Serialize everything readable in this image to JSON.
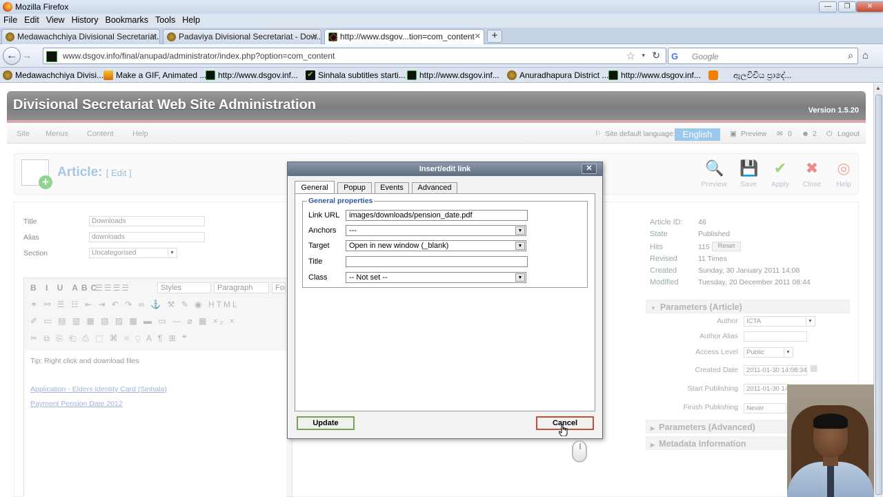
{
  "window": {
    "title": "Mozilla Firefox",
    "min": "—",
    "max": "❐",
    "close": "✕"
  },
  "menubar": [
    "File",
    "Edit",
    "View",
    "History",
    "Bookmarks",
    "Tools",
    "Help"
  ],
  "tabs": [
    {
      "label": "Medawachchiya Divisional Secretariat..."
    },
    {
      "label": "Padaviya Divisional Secretariat - Dow..."
    },
    {
      "label": "http://www.dsgov...tion=com_content"
    }
  ],
  "newtab": "+",
  "navbar": {
    "back": "←",
    "forward": "→",
    "url": "www.dsgov.info/final/anupad/administrator/index.php?option=com_content",
    "star": "☆",
    "drop": "▾",
    "reload": "↻",
    "search_engine": "G",
    "search_placeholder": "Google",
    "search_icon": "⌕",
    "home": "⌂"
  },
  "bookmarks": [
    "Medawachchiya Divisi...",
    "Make a GIF, Animated ...",
    "http://www.dsgov.inf...",
    "Sinhala subtitles starti...",
    "http://www.dsgov.inf...",
    "Anuradhapura District ...",
    "http://www.dsgov.inf...",
    "ඇලවිචිය ප්‍රාදේ..."
  ],
  "bookmark_icon_sinhala": "✔",
  "admin": {
    "title": "Divisional Secretariat Web Site Administration",
    "version": "Version 1.5.20",
    "menu": [
      "Site",
      "Menus",
      "Content",
      "Help"
    ],
    "lang_label": "Site default language:",
    "lang_value": "English",
    "status": {
      "preview": "Preview",
      "messages": "0",
      "users": "2",
      "logout": "Logout"
    }
  },
  "toolbar": {
    "title": "Article:",
    "subtitle": "[ Edit ]",
    "plus": "+",
    "buttons": [
      {
        "label": "Preview",
        "glyph": "🔍"
      },
      {
        "label": "Save",
        "glyph": "💾"
      },
      {
        "label": "Apply",
        "glyph": "✔"
      },
      {
        "label": "Close",
        "glyph": "✖"
      },
      {
        "label": "Help",
        "glyph": "◎"
      }
    ]
  },
  "form": {
    "title_label": "Title",
    "title_value": "Downloads",
    "alias_label": "Alias",
    "alias_value": "downloads",
    "section_label": "Section",
    "section_value": "Uncategorised"
  },
  "editor": {
    "row1": "B I U ABC",
    "styles": "Styles",
    "paragraph": "Paragraph",
    "font": "Fon",
    "row2": "⚭ ⚯ ☰ ☷ ⇤ ⇥ ↶ ↷ ∞ ⚓ ⚒ ✎ ◉ HTML",
    "row3": "✐ ▭ ▤ ▥ ▦ ▧ ▨ ▩ ▬ ▭ — ⌀ ▦ ×₂ ×",
    "row4": "✂ ⧉ ⎘ ⎗ ⎙ ⬚ ⌘ ⌗ ⍜ A ¶ ⊞ ❝",
    "tip": "Tip: Right click and download files",
    "link1": "Application - Elders Identity Card (Sinhala)",
    "link2": "Payment Pension Date 2012"
  },
  "info": {
    "article_id_label": "Article ID:",
    "article_id": "46",
    "state_label": "State",
    "state": "Published",
    "hits_label": "Hits",
    "hits": "115",
    "reset": "Reset",
    "revised_label": "Revised",
    "revised": "11 Times",
    "created_label": "Created",
    "created": "Sunday, 30 January 2011 14:08",
    "modified_label": "Modified",
    "modified": "Tuesday, 20 December 2011 08:44"
  },
  "params": {
    "header": "Parameters (Article)",
    "author_label": "Author",
    "author": "ICTA",
    "alias_label": "Author Alias",
    "alias": "",
    "access_label": "Access Level",
    "access": "Public",
    "created_label": "Created Date",
    "created": "2011-01-30 14:08:34",
    "start_label": "Start Publishing",
    "start": "2011-01-30 14",
    "finish_label": "Finish Publishing",
    "finish": "Never",
    "advanced": "Parameters (Advanced)",
    "metadata": "Metadata Information"
  },
  "dialog": {
    "title": "Insert/edit link",
    "close": "✕",
    "tabs": [
      "General",
      "Popup",
      "Events",
      "Advanced"
    ],
    "legend": "General properties",
    "link_url_label": "Link URL",
    "link_url": "images/downloads/pension_date.pdf",
    "anchors_label": "Anchors",
    "anchors": "---",
    "target_label": "Target",
    "target": "Open in new window (_blank)",
    "title_label": "Title",
    "title_value": "",
    "class_label": "Class",
    "class_value": "-- Not set --",
    "update": "Update",
    "cancel": "Cancel"
  }
}
